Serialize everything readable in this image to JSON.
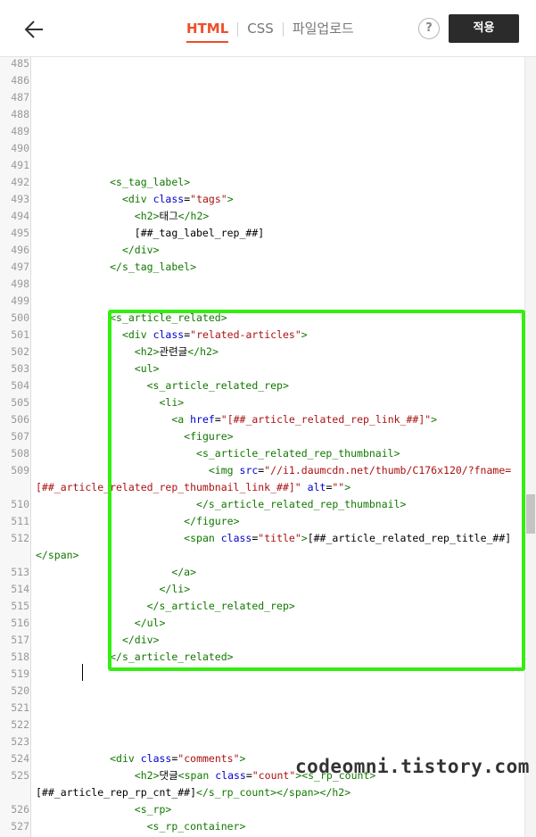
{
  "header": {
    "back_icon": "arrow-left-icon",
    "tabs": [
      {
        "label": "HTML",
        "active": true
      },
      {
        "label": "CSS",
        "active": false
      },
      {
        "label": "파일업로드",
        "active": false
      }
    ],
    "help_label": "?",
    "apply_label": "적용"
  },
  "editor": {
    "current_line": 519,
    "lines": [
      {
        "n": "485",
        "code": ""
      },
      {
        "n": "486",
        "code": ""
      },
      {
        "n": "487",
        "code": ""
      },
      {
        "n": "488",
        "code": ""
      },
      {
        "n": "489",
        "code": ""
      },
      {
        "n": "490",
        "code": ""
      },
      {
        "n": "491",
        "code": ""
      },
      {
        "n": "492",
        "code": "            <s_tag_label>"
      },
      {
        "n": "493",
        "code": "              <div class=\"tags\">"
      },
      {
        "n": "494",
        "code": "                <h2>태그</h2>"
      },
      {
        "n": "495",
        "code": "                [##_tag_label_rep_##]"
      },
      {
        "n": "496",
        "code": "              </div>"
      },
      {
        "n": "497",
        "code": "            </s_tag_label>"
      },
      {
        "n": "498",
        "code": ""
      },
      {
        "n": "499",
        "code": ""
      },
      {
        "n": "500",
        "code": "            <s_article_related>"
      },
      {
        "n": "501",
        "code": "              <div class=\"related-articles\">"
      },
      {
        "n": "502",
        "code": "                <h2>관련글</h2>"
      },
      {
        "n": "503",
        "code": "                <ul>"
      },
      {
        "n": "504",
        "code": "                  <s_article_related_rep>"
      },
      {
        "n": "505",
        "code": "                    <li>"
      },
      {
        "n": "506",
        "code": "                      <a href=\"[##_article_related_rep_link_##]\">"
      },
      {
        "n": "507",
        "code": "                        <figure>"
      },
      {
        "n": "508",
        "code": "                          <s_article_related_rep_thumbnail>"
      },
      {
        "n": "509",
        "code": "                            <img src=\"//i1.daumcdn.net/thumb/C176x120/?fname="
      },
      {
        "n": "",
        "code": "[##_article_related_rep_thumbnail_link_##]\" alt=\"\">"
      },
      {
        "n": "510",
        "code": "                          </s_article_related_rep_thumbnail>"
      },
      {
        "n": "511",
        "code": "                        </figure>"
      },
      {
        "n": "512",
        "code": "                        <span class=\"title\">[##_article_related_rep_title_##]"
      },
      {
        "n": "",
        "code": "</span>"
      },
      {
        "n": "513",
        "code": "                      </a>"
      },
      {
        "n": "514",
        "code": "                    </li>"
      },
      {
        "n": "515",
        "code": "                  </s_article_related_rep>"
      },
      {
        "n": "516",
        "code": "                </ul>"
      },
      {
        "n": "517",
        "code": "              </div>"
      },
      {
        "n": "518",
        "code": "            </s_article_related>"
      },
      {
        "n": "519",
        "code": ""
      },
      {
        "n": "520",
        "code": ""
      },
      {
        "n": "521",
        "code": ""
      },
      {
        "n": "522",
        "code": ""
      },
      {
        "n": "523",
        "code": ""
      },
      {
        "n": "524",
        "code": "            <div class=\"comments\">"
      },
      {
        "n": "525",
        "code": "                <h2>댓글<span class=\"count\"><s_rp_count>"
      },
      {
        "n": "",
        "code": "[##_article_rep_rp_cnt_##]</s_rp_count></span></h2>"
      },
      {
        "n": "526",
        "code": "                <s_rp>"
      },
      {
        "n": "527",
        "code": "                  <s_rp_container>"
      }
    ]
  },
  "watermark": "codeomni.tistory.com"
}
